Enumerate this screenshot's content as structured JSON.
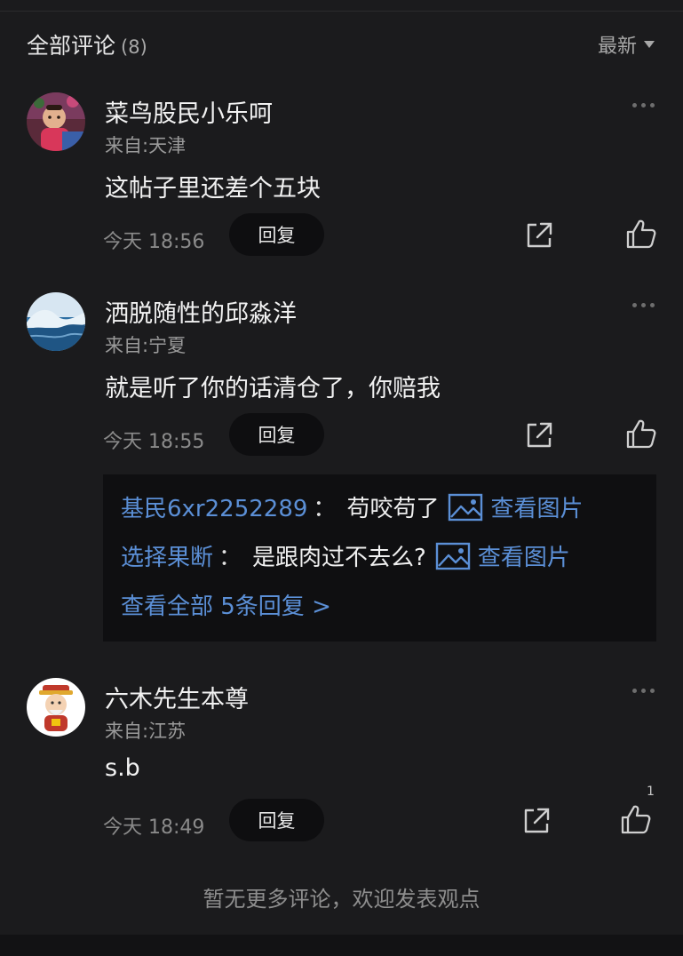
{
  "header": {
    "title": "全部评论",
    "count": "(8)",
    "sort_label": "最新"
  },
  "comments": [
    {
      "name": "菜鸟股民小乐呵",
      "location": "来自:天津",
      "content": "这帖子里还差个五块",
      "time": "今天 18:56",
      "reply_label": "回复",
      "avatar": "child-photo-avatar"
    },
    {
      "name": "洒脱随性的邱淼洋",
      "location": "来自:宁夏",
      "content": "就是听了你的话清仓了，你赔我",
      "time": "今天 18:55",
      "reply_label": "回复",
      "avatar": "ocean-wave-avatar"
    },
    {
      "name": "六木先生本尊",
      "location": "来自:江苏",
      "content": "s.b",
      "time": "今天 18:49",
      "reply_label": "回复",
      "like_count": "1",
      "avatar": "fortune-god-avatar"
    }
  ],
  "replies": {
    "items": [
      {
        "user": "基民6xr2252289",
        "colon": "：",
        "text": "苟咬苟了",
        "link": "查看图片"
      },
      {
        "user": "选择果断",
        "colon": "：",
        "text": "是跟肉过不去么?",
        "link": "查看图片"
      }
    ],
    "view_all": "查看全部 5条回复 >"
  },
  "footer": {
    "note": "暂无更多评论，欢迎发表观点"
  },
  "colors": {
    "background": "#1b1b1d",
    "link_blue": "#5b8fd6",
    "reply_panel": "#0f0f11"
  }
}
